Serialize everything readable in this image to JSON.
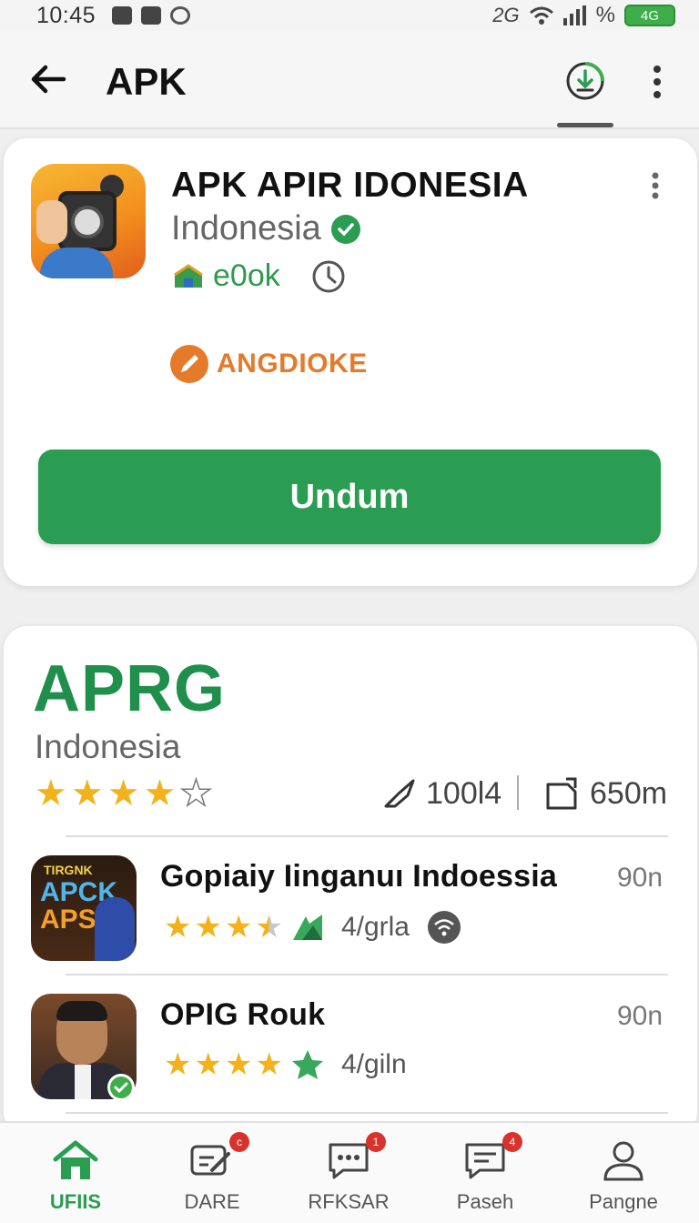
{
  "status_bar": {
    "time": "10:45",
    "network": "2G",
    "battery_label": "4G",
    "percent_sign": "%"
  },
  "app_bar": {
    "title": "APK"
  },
  "app_card": {
    "name": "APK APIR IDONESIA",
    "developer": "Indonesia",
    "tag": "e0ok",
    "category": "ANGDIOKE",
    "install_label": "Undum"
  },
  "list_section": {
    "title": "APRG",
    "subtitle": "Indonesia",
    "rating_stars": 4,
    "installs": "100l4",
    "size": "650m"
  },
  "list_items": [
    {
      "name": "Gopiaiy Iinganuı Indoessia",
      "size": "90n",
      "rating_text": "4/grla",
      "stars": 3.5,
      "thumb_text_top": "TIRGNK",
      "thumb_text_mid": "APCK",
      "thumb_text_bot": "APS"
    },
    {
      "name": "OPIG Rouk",
      "size": "90n",
      "rating_text": "4/giln",
      "stars": 4
    }
  ],
  "bottom_nav": [
    {
      "label": "UFIIS",
      "icon": "home-icon",
      "active": true,
      "badge": ""
    },
    {
      "label": "DARE",
      "icon": "edit-icon",
      "active": false,
      "badge": "c"
    },
    {
      "label": "RFKSAR",
      "icon": "chat-icon",
      "active": false,
      "badge": "1"
    },
    {
      "label": "Paseh",
      "icon": "message-icon",
      "active": false,
      "badge": "4"
    },
    {
      "label": "Pangne",
      "icon": "profile-icon",
      "active": false,
      "badge": ""
    }
  ],
  "colors": {
    "accent_green": "#2a9d52",
    "title_green": "#1f8f4b",
    "category_orange": "#e47a2a",
    "star_gold": "#f3b21c",
    "badge_red": "#d9322c"
  }
}
